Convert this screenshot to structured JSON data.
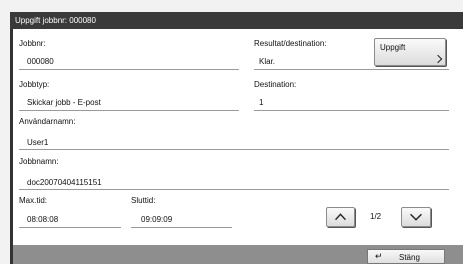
{
  "window": {
    "title": "Uppgift jobbnr: 000080"
  },
  "fields": {
    "jobbnr": {
      "label": "Jobbnr:",
      "value": "000080"
    },
    "resultat": {
      "label": "Resultat/destination:",
      "value": "Klar."
    },
    "jobbtyp": {
      "label": "Jobbtyp:",
      "value": "Skickar jobb - E-post"
    },
    "destination": {
      "label": "Destination:",
      "value": "1"
    },
    "anvandarnamn": {
      "label": "Användarnamn:",
      "value": "User1"
    },
    "jobbnamn": {
      "label": "Jobbnamn:",
      "value": "doc20070404115151"
    },
    "maxtid": {
      "label": "Max.tid:",
      "value": "08:08:08"
    },
    "sluttid": {
      "label": "Sluttid:",
      "value": "09:09:09"
    }
  },
  "buttons": {
    "uppgift": "Uppgift",
    "close": "Stäng"
  },
  "pager": {
    "page": "1/2"
  },
  "icons": {
    "enter": "↵",
    "up": "chevron-up-icon",
    "down": "chevron-down-icon"
  }
}
